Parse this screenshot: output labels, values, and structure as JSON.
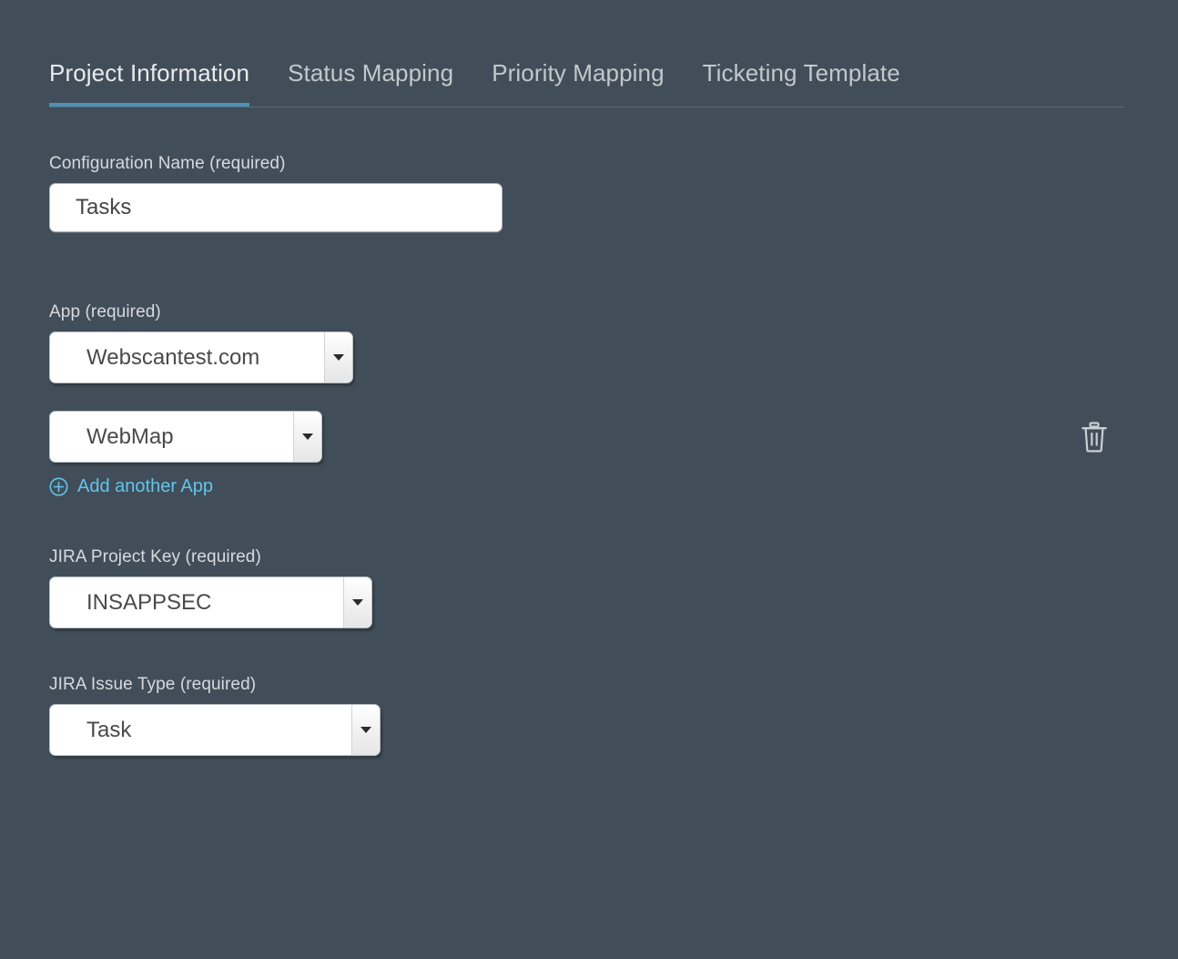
{
  "theme": {
    "background": "#414e59",
    "accent": "#4d91b5",
    "link": "#63c4ea",
    "label_text": "#d6dade",
    "active_tab_text": "#e9ebec",
    "inactive_tab_text": "#c3c8cc",
    "input_text": "#4a4a4a",
    "separator": "#5d6973"
  },
  "tabs": [
    {
      "label": "Project Information",
      "active": true
    },
    {
      "label": "Status Mapping",
      "active": false
    },
    {
      "label": "Priority Mapping",
      "active": false
    },
    {
      "label": "Ticketing Template",
      "active": false
    }
  ],
  "form": {
    "configuration_name": {
      "label": "Configuration Name (required)",
      "value": "Tasks",
      "placeholder": ""
    },
    "app": {
      "label": "App (required)",
      "selects": [
        {
          "value": "Webscantest.com"
        },
        {
          "value": "WebMap"
        }
      ],
      "delete_icon": "trash-icon",
      "add_link": {
        "label": "Add another App",
        "icon": "circle-plus-icon"
      }
    },
    "jira_project_key": {
      "label": "JIRA Project Key (required)",
      "value": "INSAPPSEC"
    },
    "jira_issue_type": {
      "label": "JIRA Issue Type (required)",
      "value": "Task"
    }
  }
}
